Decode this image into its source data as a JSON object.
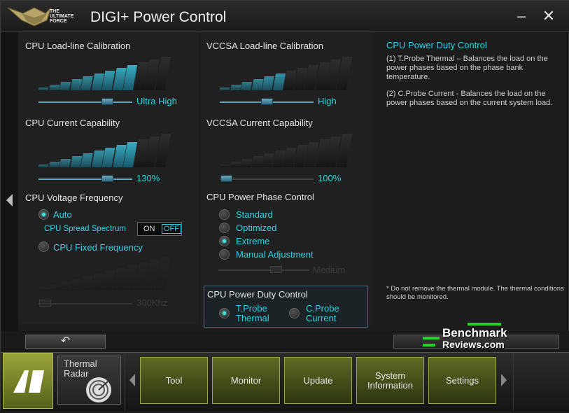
{
  "window": {
    "title": "DIGI+ Power Control",
    "logo_text": "THE ULTIMATE FORCE",
    "minimize": "–",
    "close": "✕"
  },
  "left": {
    "llc_label": "CPU Load-line Calibration",
    "llc_value": "Ultra High",
    "llc_level": 0.75,
    "cc_label": "CPU Current Capability",
    "cc_value": "130%",
    "cc_level": 0.75,
    "vf_label": "CPU Voltage Frequency",
    "auto_label": "Auto",
    "spread_label": "CPU Spread Spectrum",
    "spread_on": "ON",
    "spread_off": "OFF",
    "fixed_label": "CPU Fixed Frequency",
    "freq_value": "300Khz"
  },
  "middle": {
    "vccsa_llc_label": "VCCSA Load-line Calibration",
    "vccsa_llc_value": "High",
    "vccsa_llc_level": 0.5,
    "vccsa_cc_label": "VCCSA Current Capability",
    "vccsa_cc_value": "100%",
    "phase_label": "CPU Power Phase Control",
    "phase_options": [
      "Standard",
      "Optimized",
      "Extreme",
      "Manual Adjustment"
    ],
    "phase_selected": "Extreme",
    "phase_slider_value": "Medium",
    "duty_label": "CPU Power Duty Control",
    "duty_opt1": "T.Probe Thermal",
    "duty_opt1_l1": "T.Probe",
    "duty_opt1_l2": "Thermal",
    "duty_opt2": "C.Probe Current",
    "duty_opt2_l1": "C.Probe",
    "duty_opt2_l2": "Current"
  },
  "right": {
    "title": "CPU Power Duty Control",
    "p1": "(1) T.Probe Thermal – Balances the load on the power phases based on the phase bank temperature.",
    "p2": "(2) C.Probe Current -  Balances the load on the power phases based on the current system load.",
    "note": "* Do not remove the thermal module. The thermal conditions should be monitored."
  },
  "buttons": {
    "undo": "↶"
  },
  "watermark": {
    "line1": "Benchmark",
    "line2": "Reviews.com"
  },
  "dock": {
    "radar": "Thermal Radar",
    "tiles": [
      "Tool",
      "Monitor",
      "Update",
      "System Information",
      "Settings"
    ]
  },
  "colors": {
    "accent": "#2ed2e6",
    "dock_tile": "#5f6a24"
  }
}
